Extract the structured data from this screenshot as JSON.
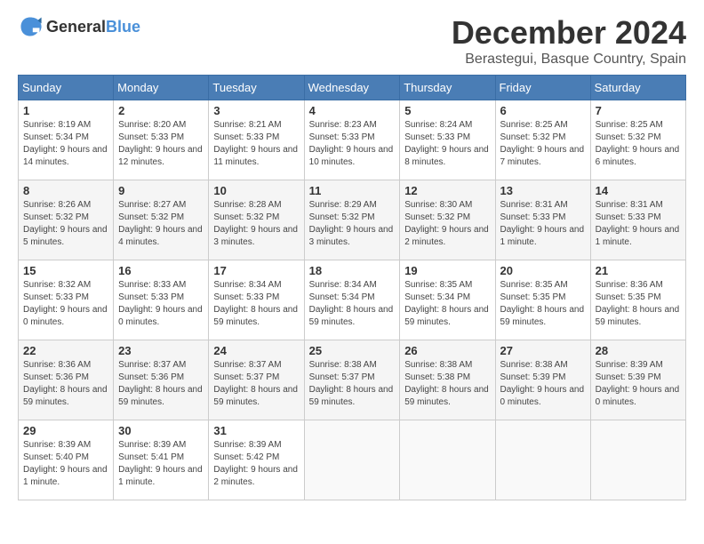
{
  "header": {
    "logo_general": "General",
    "logo_blue": "Blue",
    "month_title": "December 2024",
    "location": "Berastegui, Basque Country, Spain"
  },
  "calendar": {
    "days_of_week": [
      "Sunday",
      "Monday",
      "Tuesday",
      "Wednesday",
      "Thursday",
      "Friday",
      "Saturday"
    ],
    "weeks": [
      [
        null,
        null,
        null,
        null,
        null,
        null,
        null
      ]
    ]
  },
  "days": {
    "d1": {
      "num": "1",
      "sunrise": "8:19 AM",
      "sunset": "5:34 PM",
      "daylight": "9 hours and 14 minutes."
    },
    "d2": {
      "num": "2",
      "sunrise": "8:20 AM",
      "sunset": "5:33 PM",
      "daylight": "9 hours and 12 minutes."
    },
    "d3": {
      "num": "3",
      "sunrise": "8:21 AM",
      "sunset": "5:33 PM",
      "daylight": "9 hours and 11 minutes."
    },
    "d4": {
      "num": "4",
      "sunrise": "8:23 AM",
      "sunset": "5:33 PM",
      "daylight": "9 hours and 10 minutes."
    },
    "d5": {
      "num": "5",
      "sunrise": "8:24 AM",
      "sunset": "5:33 PM",
      "daylight": "9 hours and 8 minutes."
    },
    "d6": {
      "num": "6",
      "sunrise": "8:25 AM",
      "sunset": "5:32 PM",
      "daylight": "9 hours and 7 minutes."
    },
    "d7": {
      "num": "7",
      "sunrise": "8:25 AM",
      "sunset": "5:32 PM",
      "daylight": "9 hours and 6 minutes."
    },
    "d8": {
      "num": "8",
      "sunrise": "8:26 AM",
      "sunset": "5:32 PM",
      "daylight": "9 hours and 5 minutes."
    },
    "d9": {
      "num": "9",
      "sunrise": "8:27 AM",
      "sunset": "5:32 PM",
      "daylight": "9 hours and 4 minutes."
    },
    "d10": {
      "num": "10",
      "sunrise": "8:28 AM",
      "sunset": "5:32 PM",
      "daylight": "9 hours and 3 minutes."
    },
    "d11": {
      "num": "11",
      "sunrise": "8:29 AM",
      "sunset": "5:32 PM",
      "daylight": "9 hours and 3 minutes."
    },
    "d12": {
      "num": "12",
      "sunrise": "8:30 AM",
      "sunset": "5:32 PM",
      "daylight": "9 hours and 2 minutes."
    },
    "d13": {
      "num": "13",
      "sunrise": "8:31 AM",
      "sunset": "5:33 PM",
      "daylight": "9 hours and 1 minute."
    },
    "d14": {
      "num": "14",
      "sunrise": "8:31 AM",
      "sunset": "5:33 PM",
      "daylight": "9 hours and 1 minute."
    },
    "d15": {
      "num": "15",
      "sunrise": "8:32 AM",
      "sunset": "5:33 PM",
      "daylight": "9 hours and 0 minutes."
    },
    "d16": {
      "num": "16",
      "sunrise": "8:33 AM",
      "sunset": "5:33 PM",
      "daylight": "9 hours and 0 minutes."
    },
    "d17": {
      "num": "17",
      "sunrise": "8:34 AM",
      "sunset": "5:33 PM",
      "daylight": "8 hours and 59 minutes."
    },
    "d18": {
      "num": "18",
      "sunrise": "8:34 AM",
      "sunset": "5:34 PM",
      "daylight": "8 hours and 59 minutes."
    },
    "d19": {
      "num": "19",
      "sunrise": "8:35 AM",
      "sunset": "5:34 PM",
      "daylight": "8 hours and 59 minutes."
    },
    "d20": {
      "num": "20",
      "sunrise": "8:35 AM",
      "sunset": "5:35 PM",
      "daylight": "8 hours and 59 minutes."
    },
    "d21": {
      "num": "21",
      "sunrise": "8:36 AM",
      "sunset": "5:35 PM",
      "daylight": "8 hours and 59 minutes."
    },
    "d22": {
      "num": "22",
      "sunrise": "8:36 AM",
      "sunset": "5:36 PM",
      "daylight": "8 hours and 59 minutes."
    },
    "d23": {
      "num": "23",
      "sunrise": "8:37 AM",
      "sunset": "5:36 PM",
      "daylight": "8 hours and 59 minutes."
    },
    "d24": {
      "num": "24",
      "sunrise": "8:37 AM",
      "sunset": "5:37 PM",
      "daylight": "8 hours and 59 minutes."
    },
    "d25": {
      "num": "25",
      "sunrise": "8:38 AM",
      "sunset": "5:37 PM",
      "daylight": "8 hours and 59 minutes."
    },
    "d26": {
      "num": "26",
      "sunrise": "8:38 AM",
      "sunset": "5:38 PM",
      "daylight": "8 hours and 59 minutes."
    },
    "d27": {
      "num": "27",
      "sunrise": "8:38 AM",
      "sunset": "5:39 PM",
      "daylight": "9 hours and 0 minutes."
    },
    "d28": {
      "num": "28",
      "sunrise": "8:39 AM",
      "sunset": "5:39 PM",
      "daylight": "9 hours and 0 minutes."
    },
    "d29": {
      "num": "29",
      "sunrise": "8:39 AM",
      "sunset": "5:40 PM",
      "daylight": "9 hours and 1 minute."
    },
    "d30": {
      "num": "30",
      "sunrise": "8:39 AM",
      "sunset": "5:41 PM",
      "daylight": "9 hours and 1 minute."
    },
    "d31": {
      "num": "31",
      "sunrise": "8:39 AM",
      "sunset": "5:42 PM",
      "daylight": "9 hours and 2 minutes."
    }
  },
  "labels": {
    "sunrise": "Sunrise:",
    "sunset": "Sunset:",
    "daylight": "Daylight:"
  }
}
